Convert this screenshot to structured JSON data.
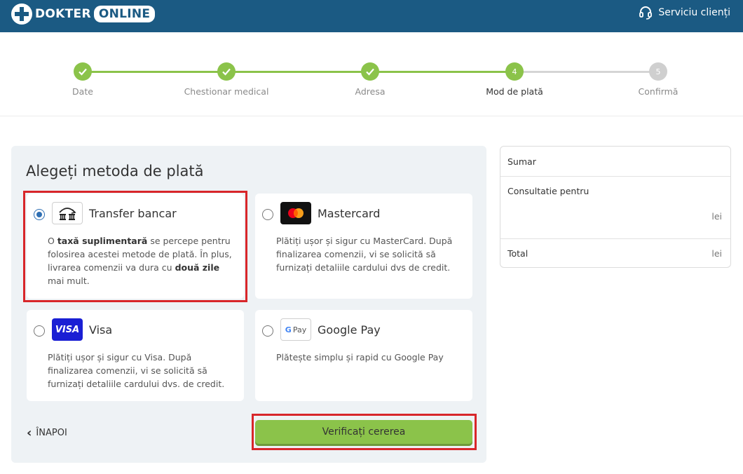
{
  "header": {
    "logo_word1": "DOKTER",
    "logo_word2": "ONLINE",
    "support_label": "Serviciu clienți"
  },
  "stepper": {
    "steps": [
      {
        "label": "Date",
        "state": "done"
      },
      {
        "label": "Chestionar medical",
        "state": "done"
      },
      {
        "label": "Adresa",
        "state": "done"
      },
      {
        "label": "Mod de plată",
        "state": "current",
        "number": "4"
      },
      {
        "label": "Confirmă",
        "state": "todo",
        "number": "5"
      }
    ]
  },
  "payment": {
    "title": "Alegeți metoda de plată",
    "methods": {
      "bank": {
        "name": "Transfer bancar",
        "selected": true,
        "desc_pre": "O ",
        "desc_bold1": "taxă suplimentară",
        "desc_mid": " se percepe pentru folosirea acestei metode de plată. În plus, livrarea comenzii va dura cu ",
        "desc_bold2": "două zile",
        "desc_post": " mai mult."
      },
      "mastercard": {
        "name": "Mastercard",
        "selected": false,
        "desc": "Plătiți ușor și sigur cu MasterCard. După finalizarea comenzii, vi se solicită să furnizați detaliile cardului dvs de credit."
      },
      "visa": {
        "name": "Visa",
        "selected": false,
        "icon_text": "VISA",
        "desc": "Plătiți ușor și sigur cu Visa. După finalizarea comenzii, vi se solicită să furnizați detaliile cardului dvs. de credit."
      },
      "googlepay": {
        "name": "Google Pay",
        "selected": false,
        "icon_text": "Pay",
        "desc": "Plătește simplu și rapid cu Google Pay"
      }
    },
    "back_label": "ÎNAPOI",
    "submit_label": "Verificați cererea"
  },
  "summary": {
    "title": "Sumar",
    "consult_label": "Consultatie pentru",
    "consult_value": "lei",
    "total_label": "Total",
    "total_value": "lei"
  },
  "colors": {
    "header_bg": "#1b5a83",
    "accent_green": "#8bc34a",
    "highlight_red": "#d8262a",
    "radio_blue": "#2f6fb3",
    "visa_blue": "#1a1fd4"
  }
}
